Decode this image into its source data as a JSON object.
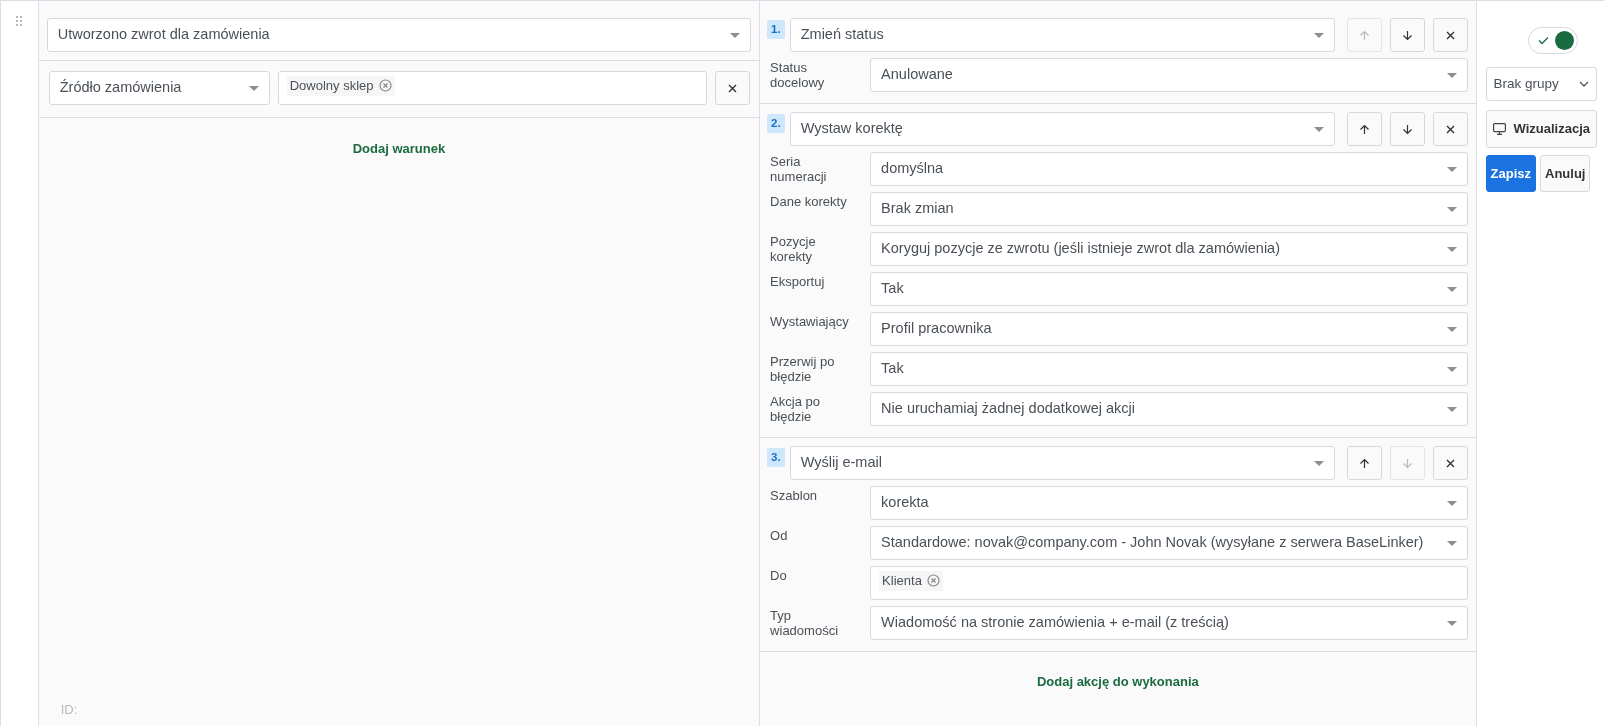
{
  "trigger": {
    "value": "Utworzono zwrot dla zamówienia"
  },
  "conditions": [
    {
      "field": "Źródło zamówienia",
      "tags": [
        "Dowolny sklep"
      ]
    }
  ],
  "add_condition": "Dodaj warunek",
  "id_label": "ID:",
  "actions": [
    {
      "number": "1.",
      "type": "Zmień status",
      "up_disabled": true,
      "down_disabled": false,
      "params": [
        {
          "label": "Status docelowy",
          "kind": "select",
          "value": "Anulowane"
        }
      ]
    },
    {
      "number": "2.",
      "type": "Wystaw korektę",
      "up_disabled": false,
      "down_disabled": false,
      "params": [
        {
          "label": "Seria numeracji",
          "kind": "select",
          "value": "domyślna"
        },
        {
          "label": "Dane korekty",
          "kind": "select",
          "value": "Brak zmian"
        },
        {
          "label": "Pozycje korekty",
          "kind": "select",
          "value": "Koryguj pozycje ze zwrotu (jeśli istnieje zwrot dla zamówienia)"
        },
        {
          "label": "Eksportuj",
          "kind": "select",
          "value": "Tak"
        },
        {
          "label": "Wystawiający",
          "kind": "select",
          "value": "Profil pracownika"
        },
        {
          "label": "Przerwij po błędzie",
          "kind": "select",
          "value": "Tak"
        },
        {
          "label": "Akcja po błędzie",
          "kind": "select",
          "value": "Nie uruchamiaj żadnej dodatkowej akcji"
        }
      ]
    },
    {
      "number": "3.",
      "type": "Wyślij e-mail",
      "up_disabled": false,
      "down_disabled": true,
      "params": [
        {
          "label": "Szablon",
          "kind": "select",
          "value": "korekta"
        },
        {
          "label": "Od",
          "kind": "select",
          "value": "Standardowe: novak@company.com - John Novak (wysyłane z serwera BaseLinker)"
        },
        {
          "label": "Do",
          "kind": "tags",
          "tags": [
            "Klienta"
          ]
        },
        {
          "label": "Typ wiadomości",
          "kind": "select",
          "value": "Wiadomość na stronie zamówienia + e-mail (z treścią)"
        }
      ]
    }
  ],
  "add_action": "Dodaj akcję do wykonania",
  "sidebar": {
    "enabled": true,
    "group": "Brak grupy",
    "buttons": [
      {
        "label": "Wizualizacja",
        "kind": "visualize"
      },
      {
        "label": "Zapisz",
        "kind": "primary"
      },
      {
        "label": "Anuluj",
        "kind": "secondary"
      }
    ]
  }
}
